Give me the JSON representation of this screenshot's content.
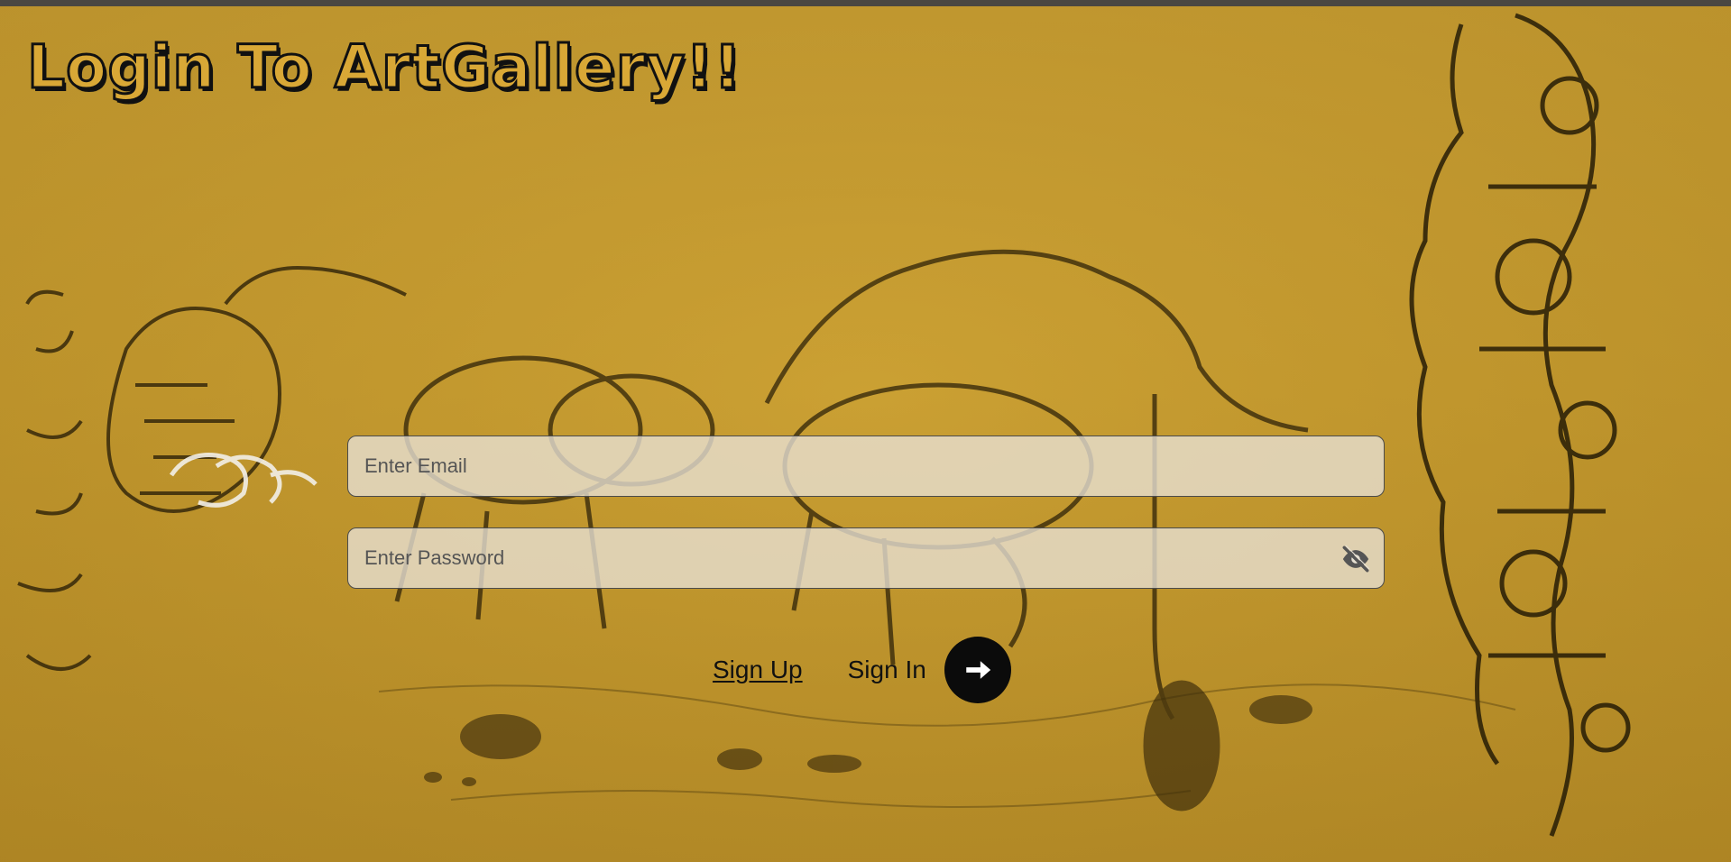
{
  "page": {
    "title": "Login To ArtGallery!!",
    "background_color": "#c69b2e"
  },
  "form": {
    "email_placeholder": "Enter Email",
    "password_placeholder": "Enter Password",
    "password_toggle_icon": "eye-off-icon",
    "signup_label": "Sign Up",
    "signin_label": "Sign In",
    "submit_icon": "arrow-right-icon",
    "accent_color": "#0b0b0b"
  }
}
